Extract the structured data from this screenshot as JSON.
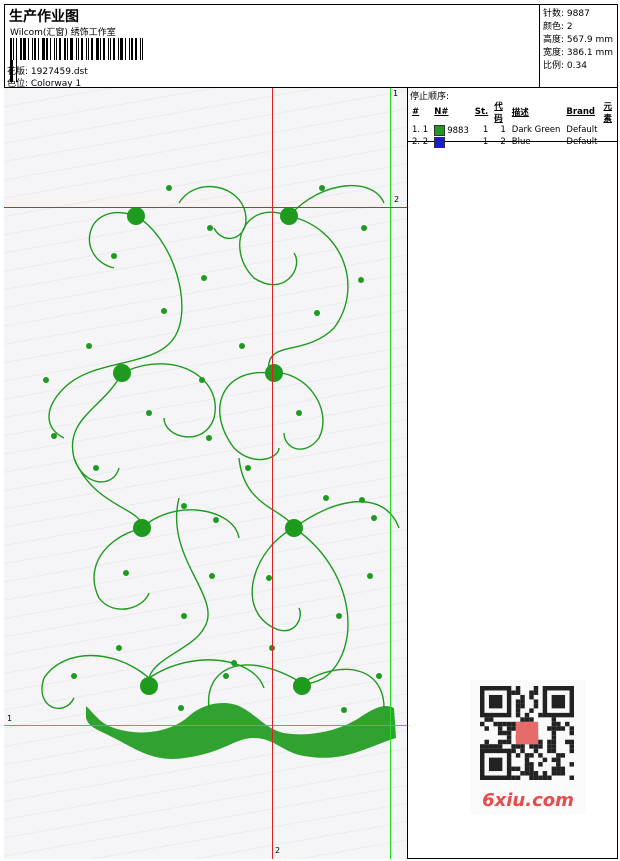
{
  "header": {
    "title": "生产作业图",
    "subtitle": "Wilcom(汇窗)​ 绣饰工作室",
    "design_label": "花版: 1927459.dst",
    "colorway_label": "色位: Colorway 1"
  },
  "stats": [
    {
      "text": "针数: 9887"
    },
    {
      "text": "颜色: 2"
    },
    {
      "text": "高度: 567.9 mm"
    },
    {
      "text": "宽度: 386.1 mm"
    },
    {
      "text": "比例: 0.34"
    }
  ],
  "stop_sequence": {
    "title": "停止顺序:",
    "columns": [
      "#",
      "N#",
      "St.",
      "代码",
      "描述",
      "Brand",
      "元素"
    ],
    "rows": [
      {
        "index": "1. 1",
        "swatch": "#1e9a1e",
        "code_num": "9883",
        "st": "1",
        "code": "1",
        "desc": "Dark Green",
        "brand": "Default"
      },
      {
        "index": "2. 2",
        "swatch": "#1a1adc",
        "code_num": "1",
        "st": "",
        "code": "2",
        "desc": "Blue",
        "brand": "Default"
      }
    ]
  },
  "canvas": {
    "axis_labels": {
      "top_green": "1",
      "left_green": "1",
      "right_red": "2",
      "bottom_red": "2"
    },
    "embroidery_color": "#1e9a1e"
  },
  "watermark": {
    "logo_text": "6xiu.com"
  }
}
